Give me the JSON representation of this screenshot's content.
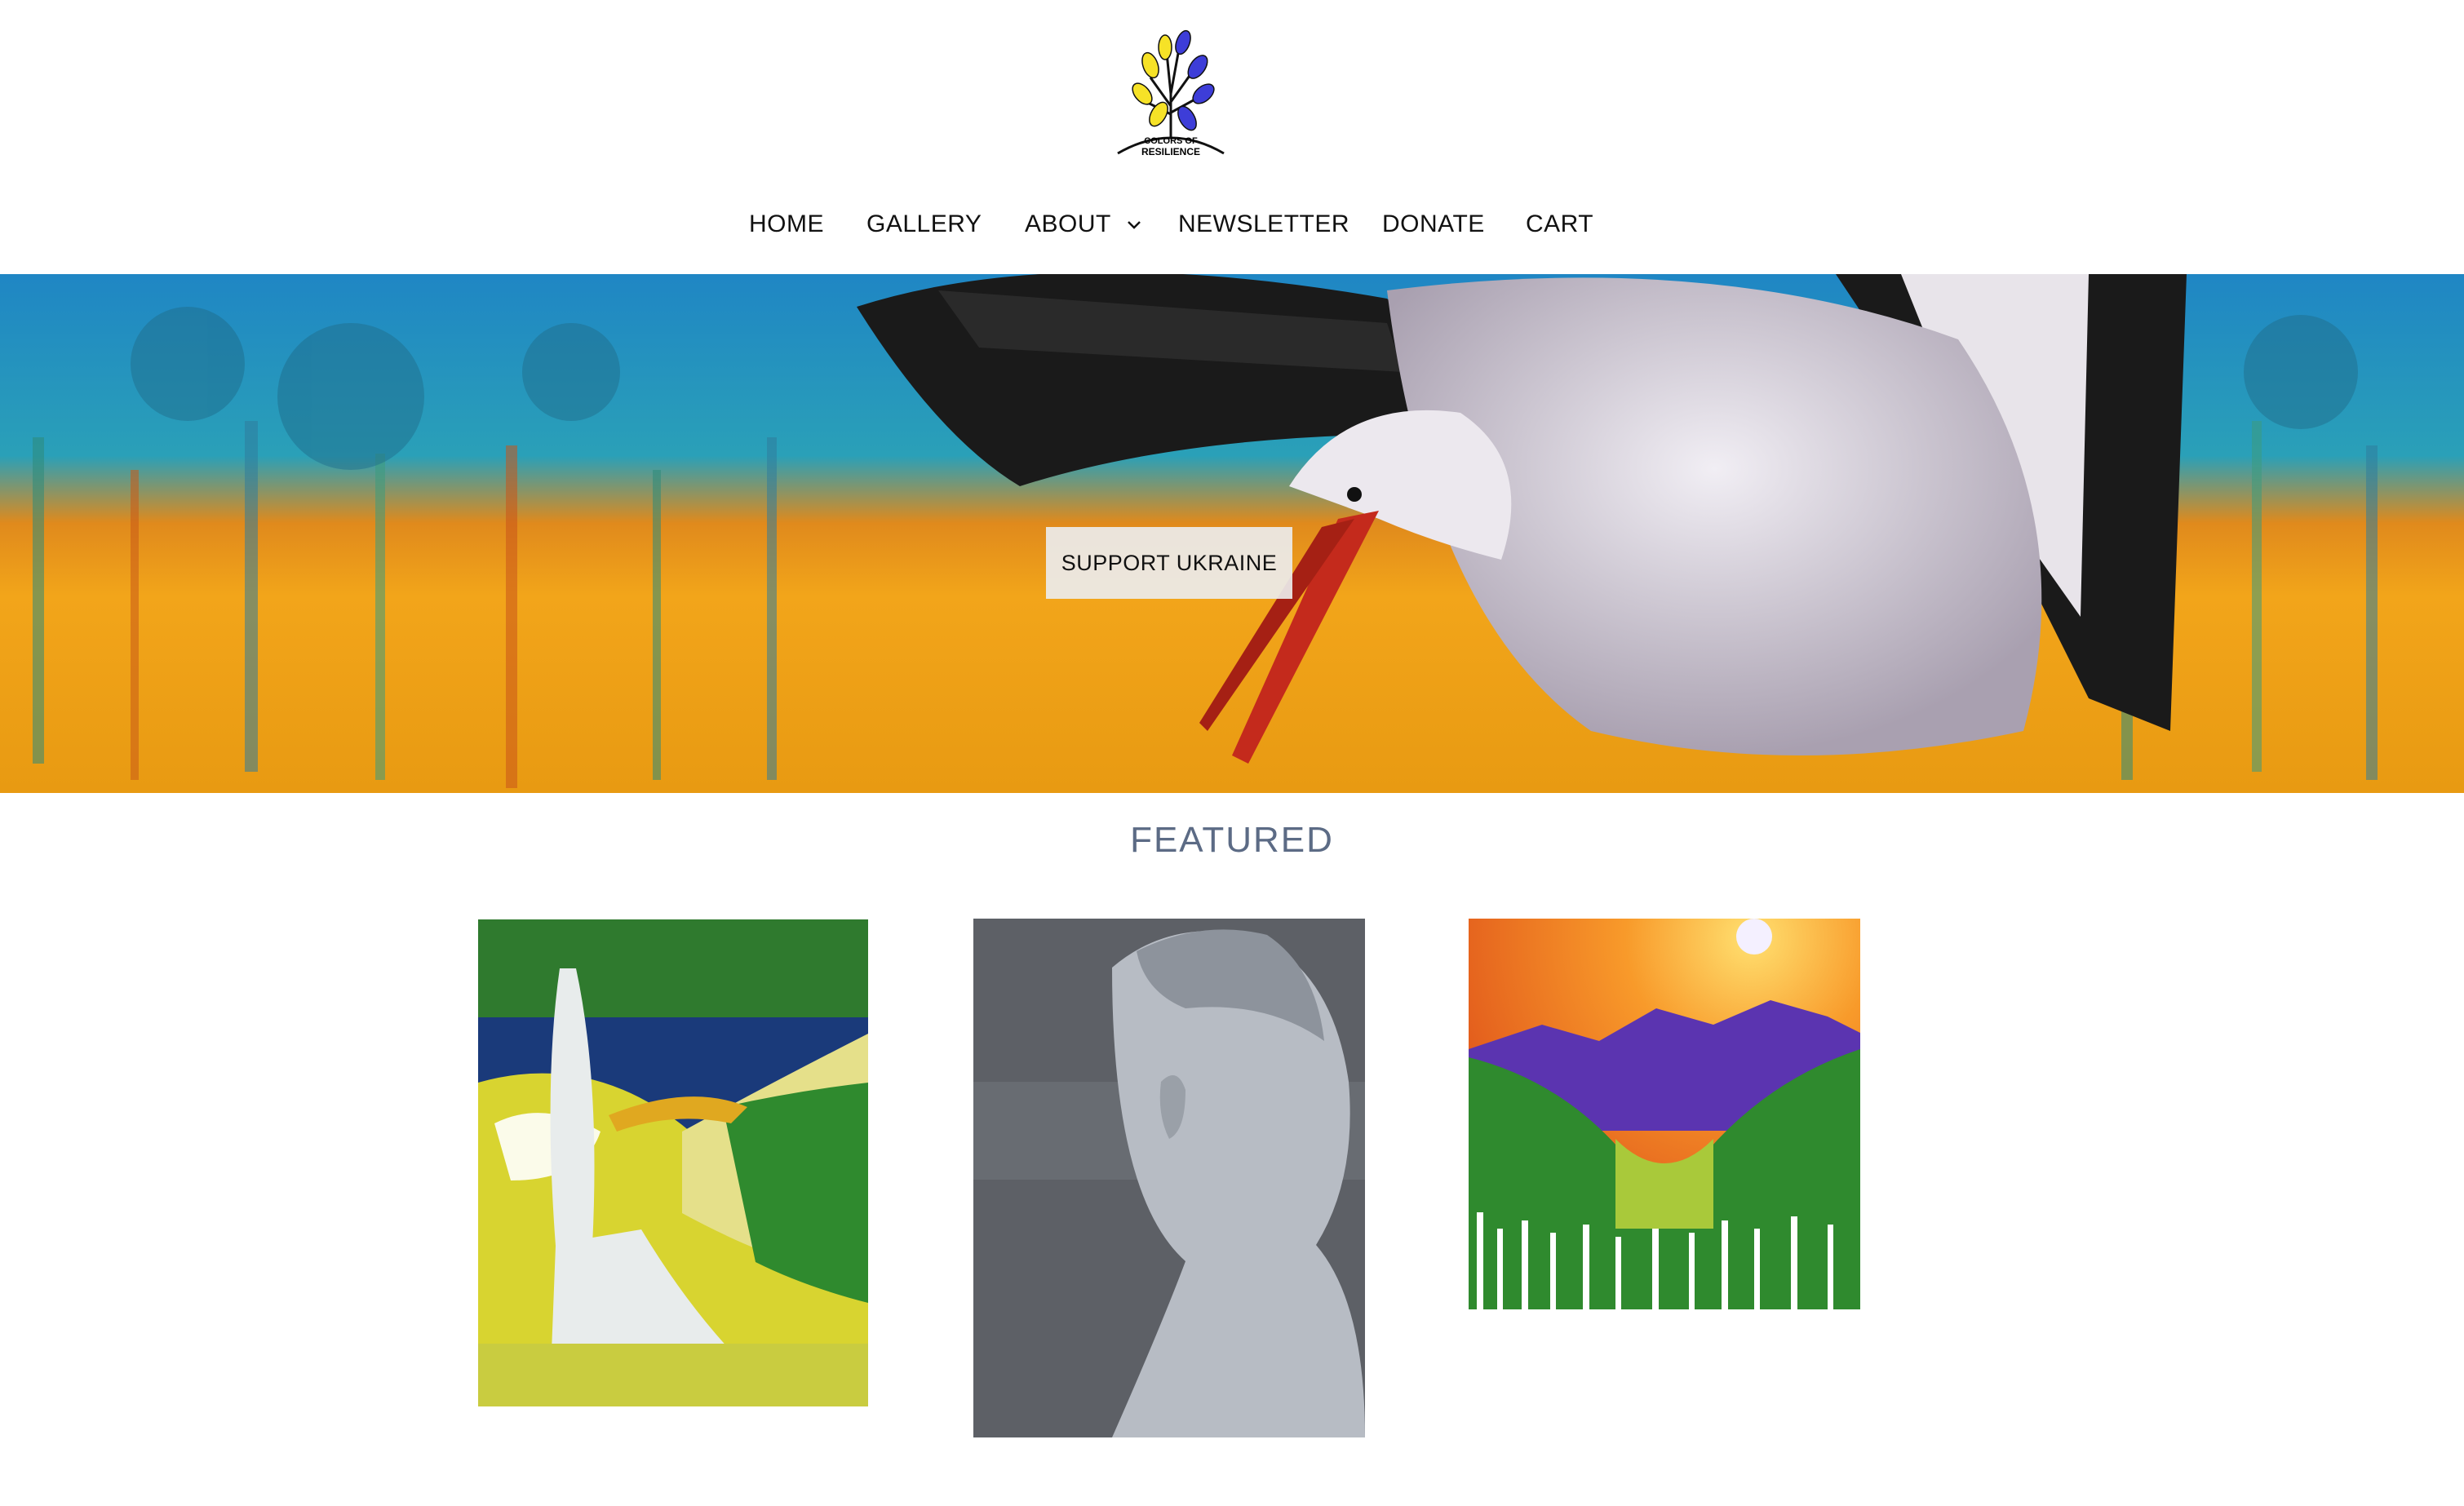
{
  "logo": {
    "line1": "COLORS OF",
    "line2": "RESILIENCE"
  },
  "nav": {
    "items": [
      {
        "label": "HOME"
      },
      {
        "label": "GALLERY"
      },
      {
        "label": "ABOUT"
      },
      {
        "label": "NEWSLETTER"
      },
      {
        "label": "DONATE"
      },
      {
        "label": "CART"
      }
    ]
  },
  "hero": {
    "cta_label": "SUPPORT UKRAINE"
  },
  "featured": {
    "title": "FEATURED"
  },
  "colors": {
    "accent_blue": "#3d3dd8",
    "accent_yellow": "#f6e227",
    "title_gray_blue": "#5c6b85"
  },
  "icons": [
    "tree-logo-icon",
    "chevron-down-icon"
  ]
}
